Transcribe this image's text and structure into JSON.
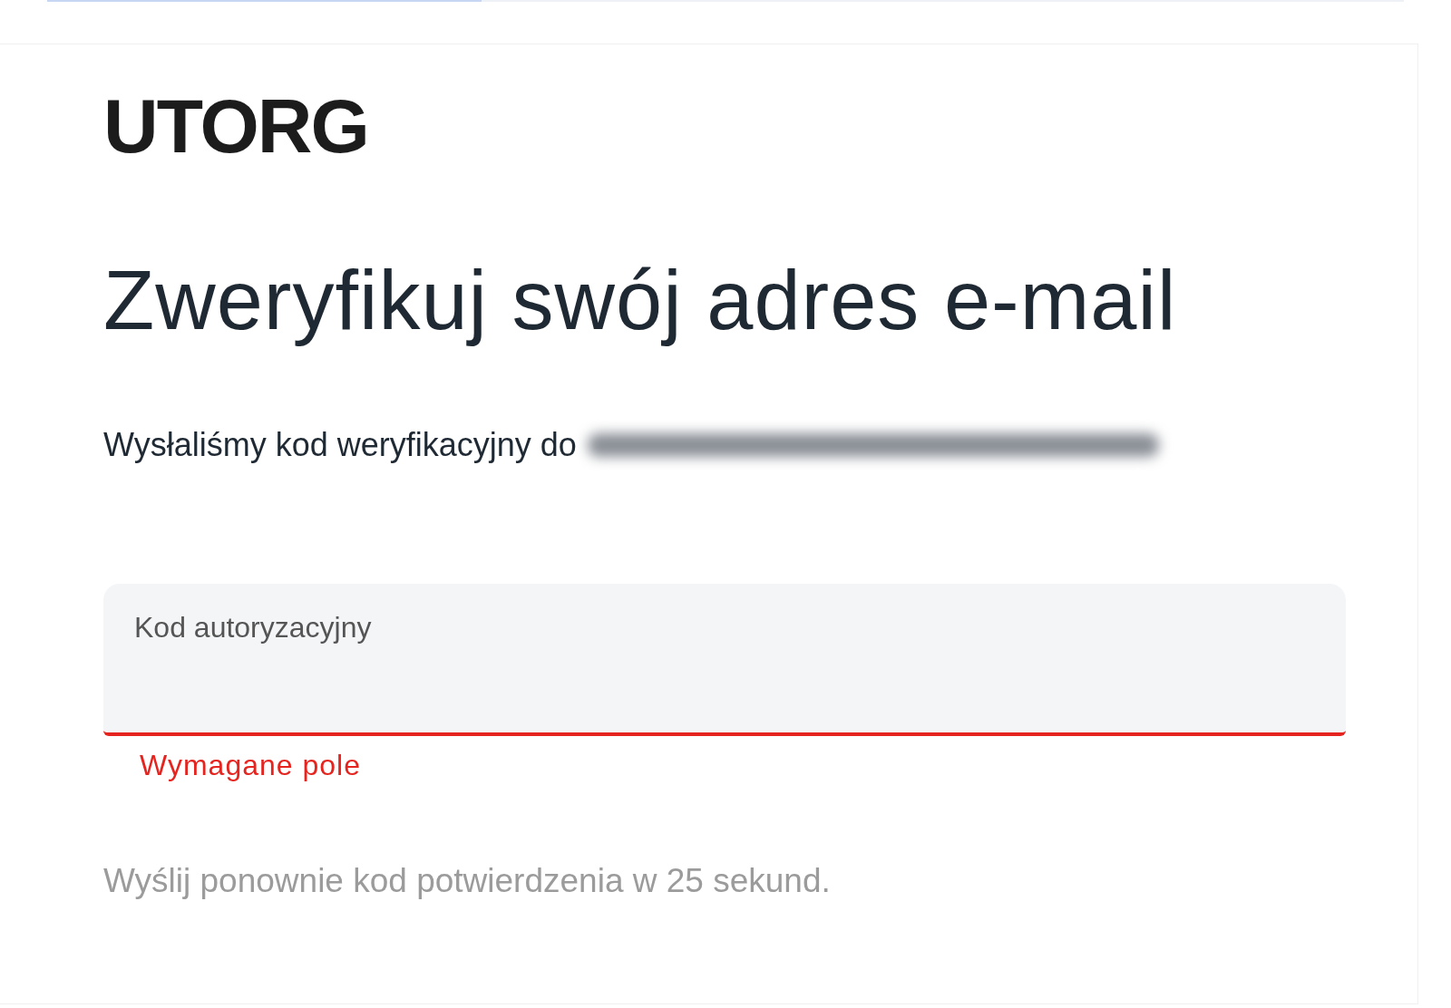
{
  "top_progress": {
    "level": 0.32
  },
  "logo": "UTORG",
  "title": "Zweryfikuj swój adres e-mail",
  "message": {
    "text": "Wysłaliśmy kod weryfikacyjny do",
    "email_redacted": true
  },
  "code_field": {
    "label": "Kod autoryzacyjny",
    "error": "Wymagane pole"
  },
  "resend_note": "Wyślij ponownie kod potwierdzenia w 25 sekund."
}
